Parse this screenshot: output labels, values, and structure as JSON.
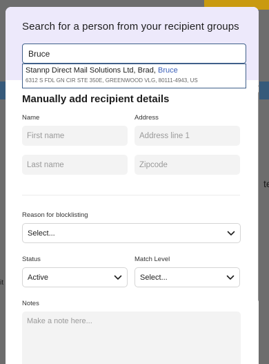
{
  "background": {
    "right_char": "te",
    "left_char": "it"
  },
  "modal": {
    "title": "Search for a person from your recipient groups",
    "search": {
      "value": "Bruce"
    },
    "suggestion": {
      "name_prefix": "Stannp Direct Mail Solutions Ltd, Brad, ",
      "name_match": "Bruce",
      "address": "6312 S FDL GN CIR STE 350E, GREENWOOD VLG, 80111-4943, US"
    },
    "manual": {
      "title": "Manually add recipient details",
      "name_label": "Name",
      "address_label": "Address",
      "first_name_placeholder": "First name",
      "last_name_placeholder": "Last name",
      "address_line1_placeholder": "Address line 1",
      "zipcode_placeholder": "Zipcode"
    },
    "blocklist": {
      "label": "Reason for blocklisting",
      "value": "Select..."
    },
    "status": {
      "label": "Status",
      "value": "Active"
    },
    "match_level": {
      "label": "Match Level",
      "value": "Select..."
    },
    "notes": {
      "label": "Notes",
      "placeholder": "Make a note here..."
    }
  },
  "colors": {
    "header_bg": "#ede9fb",
    "accent": "#3f5f8a",
    "match_highlight": "#3a5fb8"
  }
}
